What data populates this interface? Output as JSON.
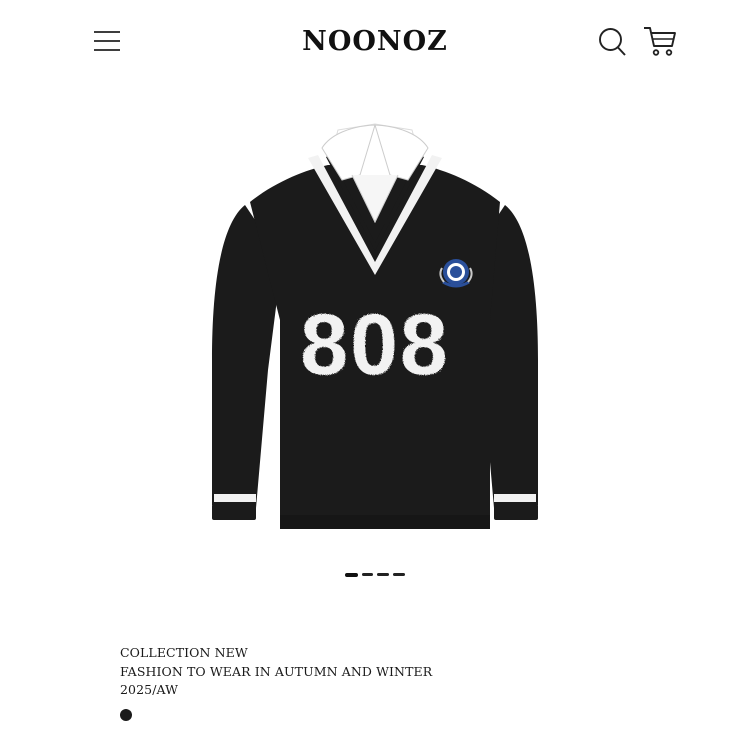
{
  "header": {
    "brand": "NOONOZ",
    "menu_icon": "hamburger-menu-icon",
    "search_icon": "search-icon",
    "cart_icon": "cart-icon"
  },
  "hero": {
    "image": "black-v-neck-sweater-808-product-photo",
    "print_text": "808",
    "slide_count": 4,
    "active_slide": 1
  },
  "caption": {
    "line1": "COLLECTION NEW",
    "line2": "FASHION TO WEAR IN AUTUMN AND WINTER",
    "line3": "2025/AW"
  },
  "colors": {
    "text": "#111111",
    "background": "#ffffff",
    "sweater": "#1b1b1b",
    "stripe": "#f2f2f2",
    "emblem": "#2a4f9a"
  }
}
